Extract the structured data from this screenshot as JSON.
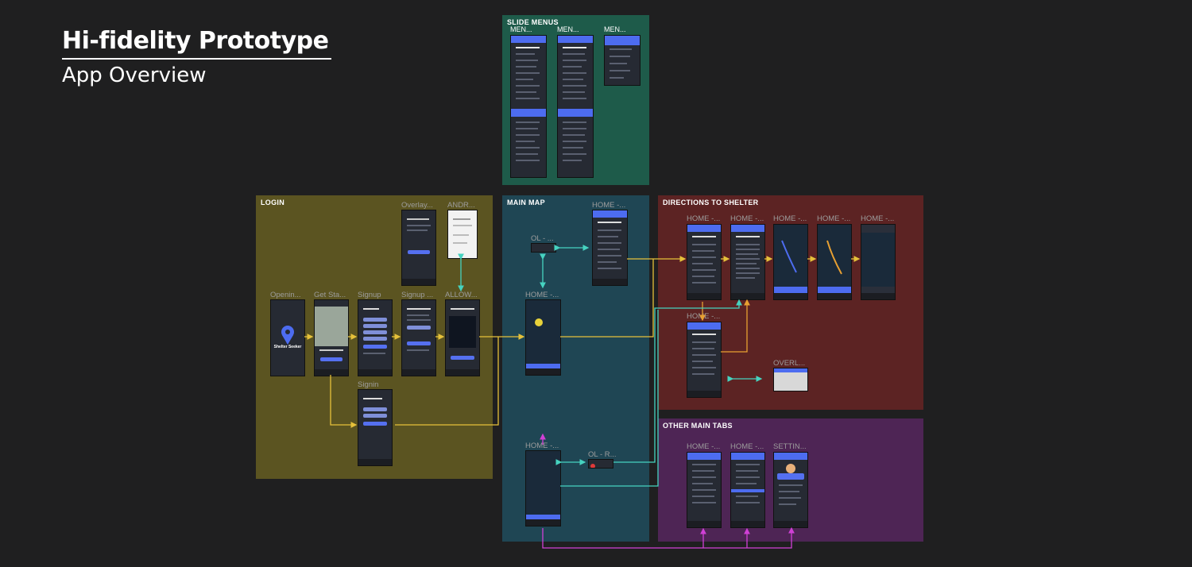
{
  "header": {
    "title": "Hi-fidelity Prototype",
    "subtitle": "App Overview"
  },
  "sections": {
    "slide_menus": "SLIDE MENUS",
    "login": "LOGIN",
    "main_map": "MAIN MAP",
    "directions": "DIRECTIONS TO SHELTER",
    "other_tabs": "OTHER MAIN TABS"
  },
  "frames": {
    "menu1": "MEN...",
    "menu2": "MEN...",
    "menu3": "MEN...",
    "opening": "Openin...",
    "get_started": "Get Sta...",
    "signup": "Signup",
    "signup2": "Signup ...",
    "allow": "ALLOW...",
    "overlay": "Overlay...",
    "android": "ANDR...",
    "signin": "Signin",
    "ol1": "OL - ...",
    "home_a": "HOME -...",
    "home_b": "HOME -...",
    "home_c": "HOME -...",
    "ol_r": "OL - R...",
    "dir1": "HOME -...",
    "dir2": "HOME -...",
    "dir3": "HOME -...",
    "dir4": "HOME -...",
    "dir5": "HOME -...",
    "dir6": "HOME -...",
    "overl": "OVERL...",
    "tab1": "HOME -...",
    "tab2": "HOME -...",
    "settings": "SETTIN..."
  },
  "screen_text": {
    "app_name": "Shelter Seeker"
  },
  "colors": {
    "background": "#1f1f20",
    "slide_menus": "#1e5b4a",
    "login": "#5b5421",
    "main_map": "#1f4654",
    "directions": "#5c2323",
    "other_tabs": "#4e2555",
    "arrow_yellow": "#e6c13a",
    "arrow_cyan": "#46d3c0",
    "arrow_magenta": "#d040d6",
    "arrow_orange": "#e8a032",
    "screen_accent": "#4d6cf0"
  }
}
